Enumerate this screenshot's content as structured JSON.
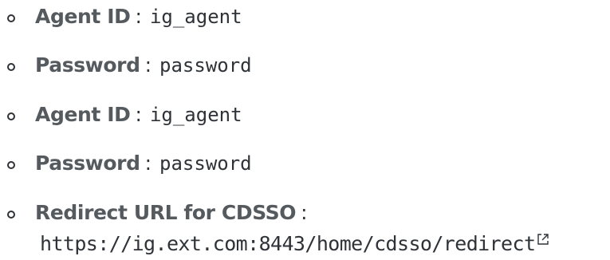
{
  "items": [
    {
      "label": "Agent ID",
      "separator": ":",
      "value": "ig_agent"
    },
    {
      "label": "Password",
      "separator": ":",
      "value": "password"
    },
    {
      "label": "Agent ID",
      "separator": ":",
      "value": "ig_agent"
    },
    {
      "label": "Password",
      "separator": ":",
      "value": "password"
    },
    {
      "label": "Redirect URL for CDSSO",
      "separator": ":",
      "value": "https://ig.ext.com:8443/home/cdsso/redirect"
    }
  ],
  "icons": {
    "bullet": "hollow-circle-bullet-icon",
    "external_link": "external-link-icon"
  },
  "colors": {
    "label": "#555a5f",
    "text": "#2f3338",
    "background": "#ffffff"
  }
}
